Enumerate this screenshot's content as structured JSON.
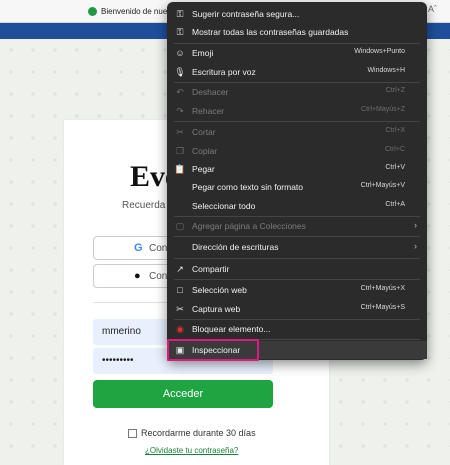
{
  "browser": {
    "tab_title": "Bienvenido de nuevo",
    "font_size_icon": "Aˆ"
  },
  "page": {
    "brand": "Eve",
    "subtitle": "Recuerda to",
    "google_button": "Conti",
    "apple_button": "Cont",
    "username": "mmerino",
    "password": "•••••••••",
    "login_button": "Acceder",
    "remember_me": "Recordarme durante 30 días",
    "forgot_password": "¿Olvidaste tu contraseña?"
  },
  "context_menu": {
    "items": [
      {
        "icon": "key-icon",
        "label": "Sugerir contraseña segura...",
        "shortcut": "",
        "enabled": true
      },
      {
        "icon": "key-icon",
        "label": "Mostrar todas las contraseñas guardadas",
        "shortcut": "",
        "enabled": true
      },
      {
        "icon": "emoji-icon",
        "label": "Emoji",
        "shortcut": "Windows+Punto",
        "enabled": true
      },
      {
        "icon": "microphone-icon",
        "label": "Escritura por voz",
        "shortcut": "Windows+H",
        "enabled": true
      },
      {
        "icon": "undo-icon",
        "label": "Deshacer",
        "shortcut": "Ctrl+Z",
        "enabled": false
      },
      {
        "icon": "redo-icon",
        "label": "Rehacer",
        "shortcut": "Ctrl+Mayús+Z",
        "enabled": false
      },
      {
        "icon": "scissors-icon",
        "label": "Cortar",
        "shortcut": "Ctrl+X",
        "enabled": false
      },
      {
        "icon": "copy-icon",
        "label": "Copiar",
        "shortcut": "Ctrl+C",
        "enabled": false
      },
      {
        "icon": "paste-icon",
        "label": "Pegar",
        "shortcut": "Ctrl+V",
        "enabled": true
      },
      {
        "icon": "",
        "label": "Pegar como texto sin formato",
        "shortcut": "Ctrl+Mayús+V",
        "enabled": true
      },
      {
        "icon": "",
        "label": "Seleccionar todo",
        "shortcut": "Ctrl+A",
        "enabled": true
      },
      {
        "icon": "collections-icon",
        "label": "Agregar página a Colecciones",
        "shortcut": "",
        "enabled": false,
        "submenu": true
      },
      {
        "icon": "",
        "label": "Dirección de escrituras",
        "shortcut": "",
        "enabled": true,
        "submenu": true
      },
      {
        "icon": "share-icon",
        "label": "Compartir",
        "shortcut": "",
        "enabled": true
      },
      {
        "icon": "web-select-icon",
        "label": "Selección web",
        "shortcut": "Ctrl+Mayús+X",
        "enabled": true
      },
      {
        "icon": "web-capture-icon",
        "label": "Captura web",
        "shortcut": "Ctrl+Mayús+S",
        "enabled": true
      },
      {
        "icon": "adblock-icon",
        "label": "Bloquear elemento...",
        "shortcut": "",
        "enabled": true
      },
      {
        "icon": "inspect-icon",
        "label": "Inspeccionar",
        "shortcut": "",
        "enabled": true,
        "highlighted": true
      }
    ]
  },
  "colors": {
    "accent_green": "#1ea440",
    "menu_bg": "#2b2b2b",
    "highlight_border": "#e0197d",
    "browser_blue": "#1f4f9a"
  }
}
